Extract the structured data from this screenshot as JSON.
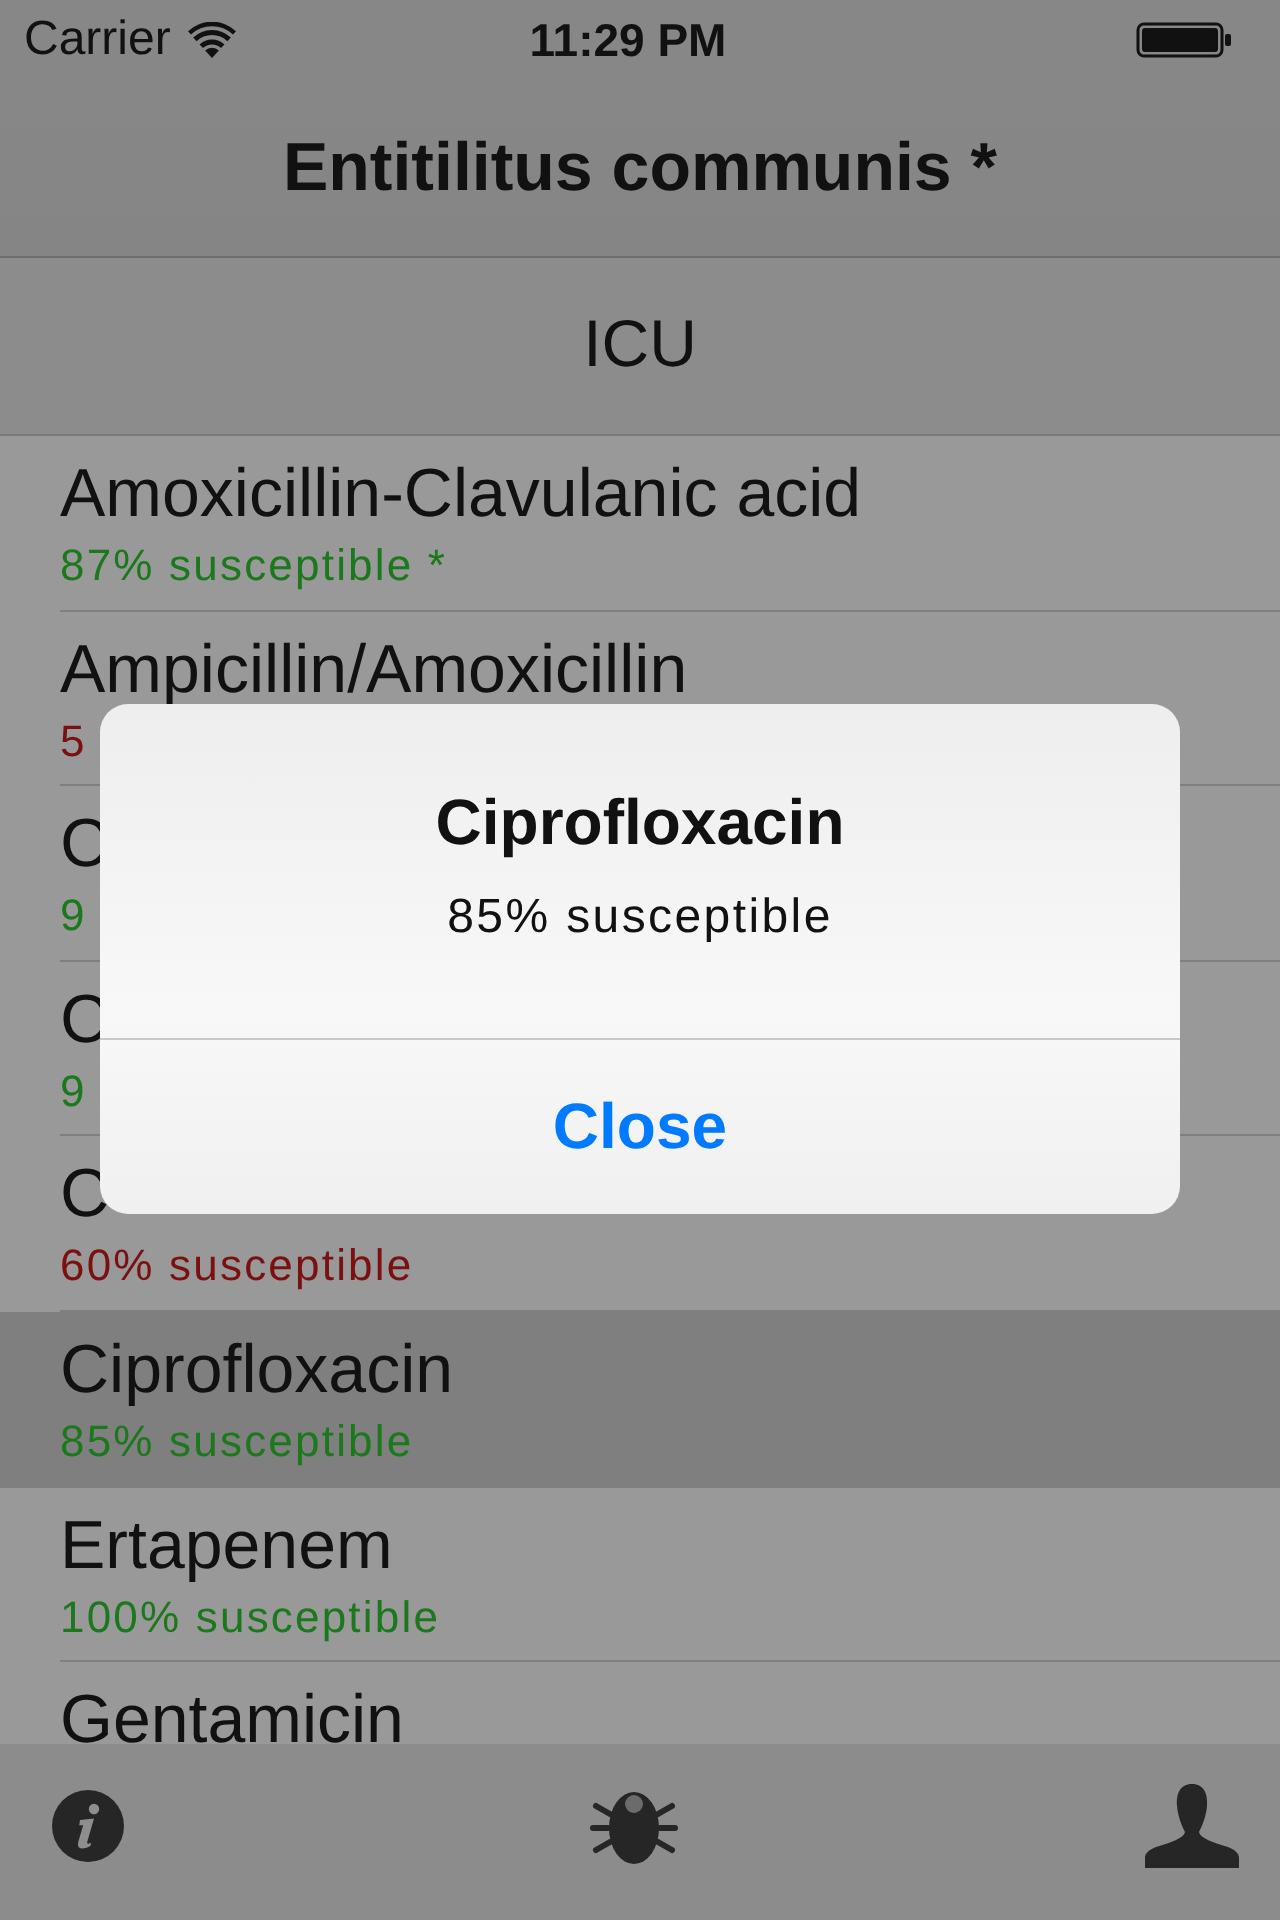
{
  "status_bar": {
    "carrier": "Carrier",
    "time": "11:29 PM"
  },
  "nav_bar": {
    "title": "Entitilitus communis *"
  },
  "section_button": {
    "label": "ICU"
  },
  "rows": [
    {
      "name": "Amoxicillin-Clavulanic acid",
      "subtitle": "87% susceptible *",
      "color": "#1c781c",
      "selected": false
    },
    {
      "name": "Ampicillin/Amoxicillin",
      "subtitle": "5",
      "color": "#7a1010",
      "selected": false
    },
    {
      "name": "C",
      "subtitle": "9",
      "color": "#1c781c",
      "selected": false
    },
    {
      "name": "C",
      "subtitle": "9",
      "color": "#1c781c",
      "selected": false
    },
    {
      "name": "C",
      "subtitle": "60% susceptible",
      "color": "#7a1010",
      "selected": false
    },
    {
      "name": "Ciprofloxacin",
      "subtitle": "85% susceptible",
      "color": "#1c781c",
      "selected": true
    },
    {
      "name": "Ertapenem",
      "subtitle": "100% susceptible",
      "color": "#1c781c",
      "selected": false
    },
    {
      "name": "Gentamicin",
      "selected": false
    }
  ],
  "alert": {
    "title": "Ciprofloxacin",
    "message": "85% susceptible",
    "button": "Close"
  }
}
